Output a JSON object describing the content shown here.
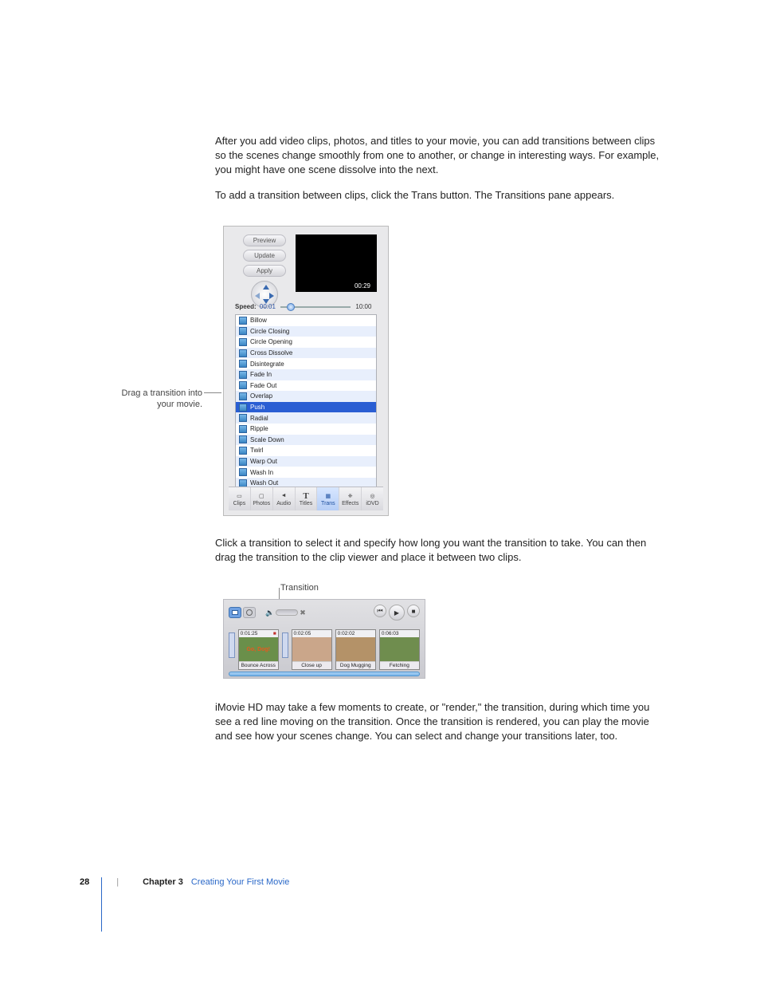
{
  "paragraphs": {
    "p1": "After you add video clips, photos, and titles to your movie, you can add transitions between clips so the scenes change smoothly from one to another, or change in interesting ways. For example, you might have one scene dissolve into the next.",
    "p2": "To add a transition between clips, click the Trans button. The Transitions pane appears.",
    "p3": "Click a transition to select it and specify how long you want the transition to take. You can then drag the transition to the clip viewer and place it between two clips.",
    "p4": "iMovie HD may take a few moments to create, or \"render,\" the transition, during which time you see a red line moving on the transition. Once the transition is rendered, you can play the movie and see how your scenes change. You can select and change your transitions later, too."
  },
  "callouts": {
    "drag_line1": "Drag a transition into",
    "drag_line2": "your movie.",
    "transition_label": "Transition"
  },
  "transitions_pane": {
    "buttons": {
      "preview": "Preview",
      "update": "Update",
      "apply": "Apply"
    },
    "preview_time": "00:29",
    "speed": {
      "label": "Speed:",
      "min": "00:01",
      "max": "10:00"
    },
    "list": [
      "Billow",
      "Circle Closing",
      "Circle Opening",
      "Cross Dissolve",
      "Disintegrate",
      "Fade In",
      "Fade Out",
      "Overlap",
      "Push",
      "Radial",
      "Ripple",
      "Scale Down",
      "Twirl",
      "Warp Out",
      "Wash In",
      "Wash Out"
    ],
    "selected": "Push",
    "tabs": [
      "Clips",
      "Photos",
      "Audio",
      "Titles",
      "Trans",
      "Effects",
      "iDVD"
    ],
    "active_tab": "Trans"
  },
  "timeline": {
    "clips": [
      {
        "dur": "0:01:25",
        "name": "Bounce Across",
        "color": "#6a8f4a",
        "flag": true,
        "title_overlay": "Go, Dog!"
      },
      {
        "dur": "0:02:05",
        "name": "Close up",
        "color": "#caa68a"
      },
      {
        "dur": "0:02:02",
        "name": "Dog Mugging",
        "color": "#b49268"
      },
      {
        "dur": "0:06:03",
        "name": "Fetching",
        "color": "#6f8d4e"
      }
    ]
  },
  "footer": {
    "page_number": "28",
    "chapter_label": "Chapter 3",
    "chapter_title": "Creating Your First Movie"
  }
}
